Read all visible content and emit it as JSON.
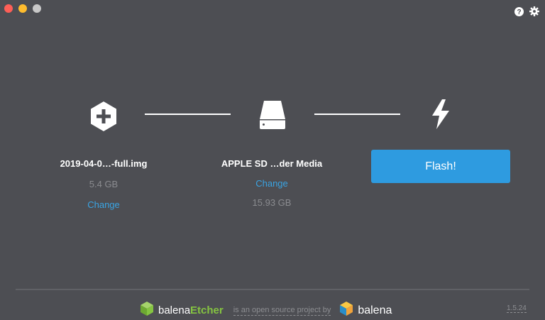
{
  "window": {
    "controls": [
      "close",
      "minimize",
      "zoom"
    ]
  },
  "toolbar": {
    "help_icon": "help-icon",
    "settings_icon": "gear-icon"
  },
  "steps": {
    "image": {
      "name": "2019-04-0…-full.img",
      "size": "5.4 GB",
      "change_label": "Change"
    },
    "drive": {
      "name": "APPLE SD …der Media",
      "change_label": "Change",
      "size": "15.93 GB"
    },
    "flash": {
      "button_label": "Flash!"
    }
  },
  "footer": {
    "brand_prefix": "balena",
    "brand_suffix": "Etcher",
    "tagline": "is an open source project by",
    "company": "balena",
    "version": "1.5.24"
  },
  "colors": {
    "background": "#4d4e53",
    "accent": "#2e9be0",
    "link": "#3aa4e3",
    "brand_green": "#85c441"
  }
}
